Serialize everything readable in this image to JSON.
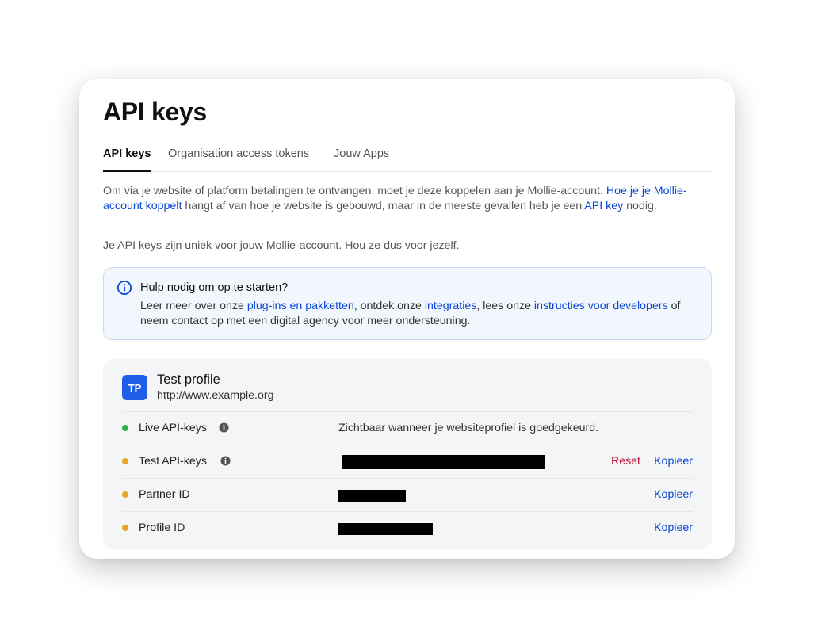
{
  "page": {
    "title": "API keys"
  },
  "tabs": [
    {
      "label": "API keys",
      "active": true
    },
    {
      "label": "Organisation access tokens",
      "active": false
    },
    {
      "label": "Jouw Apps",
      "active": false
    }
  ],
  "intro": {
    "text1": "Om via je website of platform betalingen te ontvangen, moet je deze koppelen aan je Mollie-account. ",
    "link1": "Hoe je je Mollie-account koppelt",
    "text2": " hangt af van hoe je website is gebouwd, maar in de meeste gevallen heb je een ",
    "link2": "API key",
    "text3": " nodig.",
    "note": "Je API keys zijn uniek voor jouw Mollie-account. Hou ze dus voor jezelf."
  },
  "help": {
    "icon": "info-circle-icon",
    "title": "Hulp nodig om op te starten?",
    "text1": "Leer meer over onze ",
    "link1": "plug-ins en pakketten",
    "text2": ", ontdek onze ",
    "link2": "integraties",
    "text3": ", lees onze ",
    "link3": "instructies voor developers",
    "text4": " of neem contact op met een digital agency voor meer ondersteuning."
  },
  "profile": {
    "initials": "TP",
    "name": "Test profile",
    "url": "http://www.example.org",
    "rows": [
      {
        "label": "Live API-keys",
        "status": "green",
        "value": "Zichtbaar wanneer je websiteprofiel is goedgekeurd.",
        "redacted": false
      },
      {
        "label": "Test API-keys",
        "status": "amber",
        "redacted": true,
        "reset": "Reset",
        "copy": "Kopieer"
      },
      {
        "label": "Partner ID",
        "status": "amber",
        "redacted": true,
        "copy": "Kopieer"
      },
      {
        "label": "Profile ID",
        "status": "amber",
        "redacted": true,
        "copy": "Kopieer"
      }
    ]
  },
  "colors": {
    "link": "#0a47d6",
    "danger": "#c8163a",
    "avatar": "#1d5de8",
    "status_green": "#2ab14b",
    "status_amber": "#e4a72a"
  }
}
